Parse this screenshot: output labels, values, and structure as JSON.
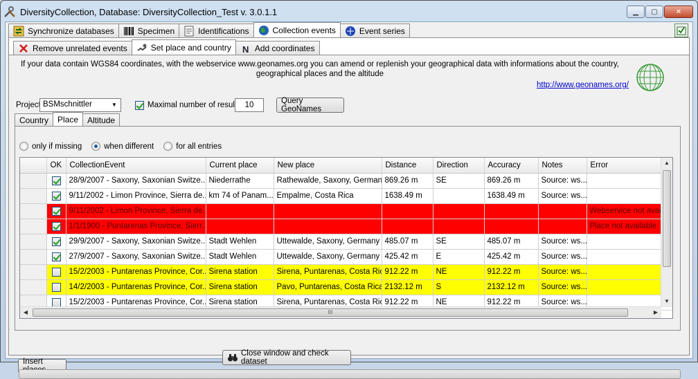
{
  "window": {
    "title": "DiversityCollection,  Database: DiversityCollection_Test    v. 3.0.1.1"
  },
  "main_tabs": [
    {
      "label": "Synchronize databases",
      "icon": "sync-icon"
    },
    {
      "label": "Specimen",
      "icon": "barcode-icon"
    },
    {
      "label": "Identifications",
      "icon": "identification-icon"
    },
    {
      "label": "Collection events",
      "icon": "globe-icon",
      "active": true
    },
    {
      "label": "Event series",
      "icon": "event-series-icon"
    }
  ],
  "sub_tabs": [
    {
      "label": "Remove unrelated events",
      "icon": "red-x-icon"
    },
    {
      "label": "Set place and country",
      "icon": "map-pin-icon",
      "active": true
    },
    {
      "label": "Add coordinates",
      "icon": "north-icon"
    }
  ],
  "info_text": "If your data contain WGS84 coordinates, with the webservice www.geonames.org you can amend or replenish your geographical data with informations about the country,  geographical places and the altitude",
  "link_text": "http://www.geonames.org/",
  "project_label": "Project:",
  "project_value": "BSMschnittler",
  "max_results_label": "Maximal number of results:",
  "max_results_checked": true,
  "max_results_value": "10",
  "query_button": "Query GeoNames",
  "inner_tabs": [
    {
      "label": "Country"
    },
    {
      "label": "Place",
      "active": true
    },
    {
      "label": "Altitude"
    }
  ],
  "radio_options": [
    {
      "label": "only if missing",
      "selected": false
    },
    {
      "label": "when different",
      "selected": true
    },
    {
      "label": "for all entries",
      "selected": false
    }
  ],
  "grid": {
    "columns": [
      "OK",
      "CollectionEvent",
      "Current place",
      "New place",
      "Distance",
      "Direction",
      "Accuracy",
      "Notes",
      "Error"
    ],
    "rows": [
      {
        "status": "normal",
        "ok": true,
        "event": "28/9/2007 - Saxony, Saxonian Switze...",
        "current": "Niederrathe",
        "new": "Rathewalde, Saxony, Germany",
        "distance": "869.26 m",
        "direction": "SE",
        "accuracy": "869.26 m",
        "notes": "Source: ws...",
        "error": ""
      },
      {
        "status": "normal",
        "ok": true,
        "event": "9/11/2002 - Limon Province, Sierra de...",
        "current": "km 74 of Panam...",
        "new": "Empalme, Costa Rica",
        "distance": "1638.49 m",
        "direction": "",
        "accuracy": "1638.49 m",
        "notes": "Source: ws...",
        "error": ""
      },
      {
        "status": "error",
        "ok": true,
        "event": "9/11/2002 - Limon Province, Sierra de...",
        "current": "",
        "new": "",
        "distance": "",
        "direction": "",
        "accuracy": "",
        "notes": "",
        "error": "Webservice not avail"
      },
      {
        "status": "error",
        "ok": true,
        "event": "1/1/1900 - Puntarenas Province, Sierr...",
        "current": "",
        "new": "",
        "distance": "",
        "direction": "",
        "accuracy": "",
        "notes": "",
        "error": "Place not available"
      },
      {
        "status": "normal",
        "ok": true,
        "event": "29/9/2007 - Saxony, Saxonian Switze...",
        "current": "Stadt Wehlen",
        "new": "Uttewalde, Saxony, Germany",
        "distance": "485.07 m",
        "direction": "SE",
        "accuracy": "485.07 m",
        "notes": "Source: ws...",
        "error": ""
      },
      {
        "status": "normal",
        "ok": true,
        "event": "27/9/2007 - Saxony, Saxonian Switze...",
        "current": "Stadt Wehlen",
        "new": "Uttewalde, Saxony, Germany",
        "distance": "425.42 m",
        "direction": "E",
        "accuracy": "425.42 m",
        "notes": "Source: ws...",
        "error": ""
      },
      {
        "status": "warning",
        "ok": false,
        "event": "15/2/2003 - Puntarenas Province, Cor...",
        "current": "Sirena station",
        "new": "Sirena, Puntarenas, Costa Rica",
        "distance": "912.22 m",
        "direction": "NE",
        "accuracy": "912.22 m",
        "notes": "Source: ws...",
        "error": ""
      },
      {
        "status": "warning",
        "ok": false,
        "event": "14/2/2003 - Puntarenas Province, Cor...",
        "current": "Sirena station",
        "new": "Pavo, Puntarenas, Costa Rica",
        "distance": "2132.12 m",
        "direction": "S",
        "accuracy": "2132.12 m",
        "notes": "Source: ws...",
        "error": ""
      },
      {
        "status": "normal",
        "ok": false,
        "event": "15/2/2003 - Puntarenas Province, Cor...",
        "current": "Sirena station",
        "new": "Sirena, Puntarenas, Costa Rica",
        "distance": "912.22 m",
        "direction": "NE",
        "accuracy": "912.22 m",
        "notes": "Source: ws...",
        "error": ""
      }
    ]
  },
  "insert_button": "Insert places",
  "close_button": "Close window and check dataset",
  "colors": {
    "error_row": "#ff0000",
    "warning_row": "#ffff00",
    "link": "#0000cc"
  }
}
